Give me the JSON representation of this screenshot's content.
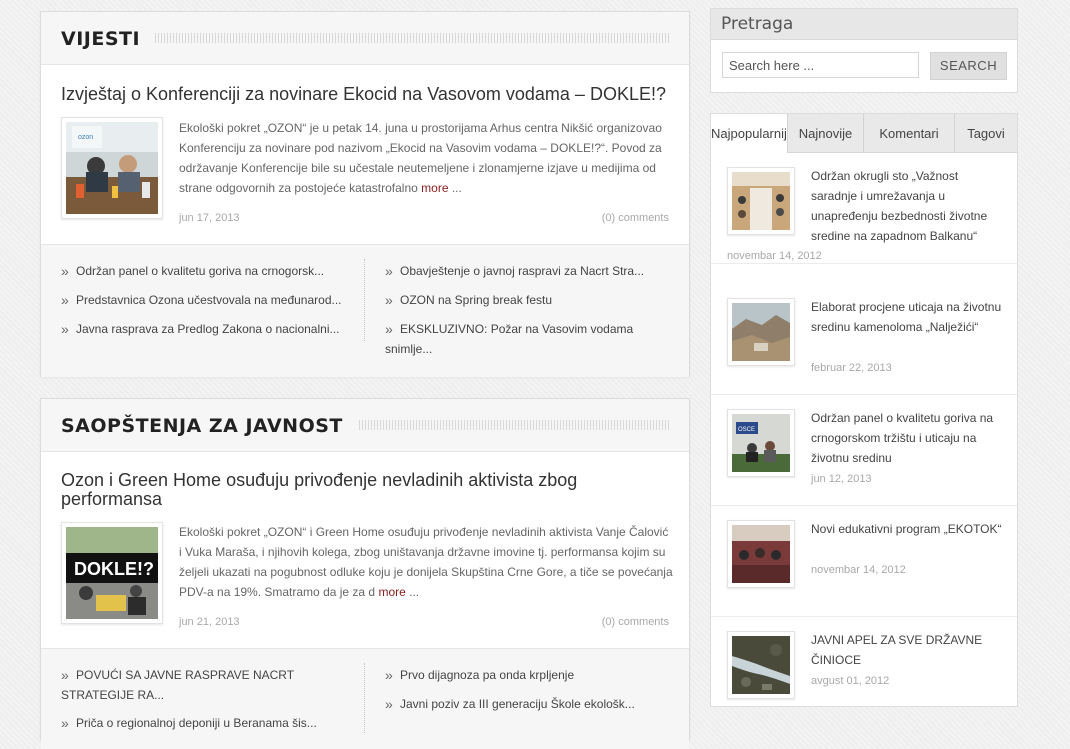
{
  "vijesti": {
    "heading": "VIJESTI",
    "post": {
      "title": "Izvještaj o Konferenciji za novinare Ekocid na Vasovom vodama – DOKLE!?",
      "excerpt": "Ekološki pokret „OZON“ je u petak 14. juna u prostorijama Arhus centra Nikšić organizovao Konferenciju za novinare pod nazivom „Ekocid na Vasovim vodama – DOKLE!?“. Povod za održavanje Konferencije bile su učestale neutemeljene i zlonamjerne izjave u medijima od strane odgovornih za postojeće katastrofalno",
      "more": "more",
      "ellipsis": " ...",
      "date": "jun 17, 2013",
      "comments": "(0) comments"
    },
    "links_left": [
      "Održan panel o kvalitetu goriva na crnogorsk...",
      "Predstavnica Ozona učestvovala na međunarod...",
      "Javna rasprava za Predlog Zakona o nacionalni..."
    ],
    "links_right": [
      "Obavještenje o javnoj raspravi za Nacrt Stra...",
      "OZON na Spring break festu",
      "EKSKLUZIVNO: Požar na Vasovim vodama snimlje..."
    ]
  },
  "saopstenja": {
    "heading": "SAOPŠTENJA ZA JAVNOST",
    "post": {
      "title": "Ozon i Green Home osuđuju privođenje nevladinih aktivista zbog performansa",
      "excerpt": "Ekološki pokret „OZON“ i Green Home osuđuju privođenje nevladinih aktivista Vanje Čalović i Vuka Maraša, i njihovih kolega, zbog uništavanja državne imovine tj. performansa kojim su željeli ukazati na pogubnost odluke koju je donijela Skupština Crne Gore, a tiče se povećanja PDV-a na 19%. Smatramo da je za d",
      "more": "more",
      "ellipsis": " ...",
      "date": "jun 21, 2013",
      "comments": "(0) comments"
    },
    "links_left": [
      "POVUĆI SA JAVNE RASPRAVE NACRT STRATEGIJE RA...",
      "Priča o regionalnoj deponiji u Beranama šis..."
    ],
    "links_right": [
      "Prvo dijagnoza pa onda krpljenje",
      "Javni poziv za III generaciju Škole ekološk..."
    ]
  },
  "search": {
    "title": "Pretraga",
    "placeholder": "Search here ...",
    "button": "SEARCH"
  },
  "tabs": [
    "Najpopularnije",
    "Najnovije",
    "Komentari",
    "Tagovi"
  ],
  "popular": [
    {
      "title": "Održan okrugli sto „Važnost saradnje i umrežavanja u unapređenju bezbednosti životne sredine na zapadnom Balkanu“",
      "date": "novembar 14, 2012"
    },
    {
      "title": "Elaborat procjene uticaja na životnu sredinu kamenoloma „Nalježići“",
      "date": "februar 22, 2013"
    },
    {
      "title": "Održan panel o kvalitetu goriva na crnogorskom tržištu i uticaju na životnu sredinu",
      "date": "jun 12, 2013"
    },
    {
      "title": "Novi edukativni program „EKOTOK“",
      "date": "novembar 14, 2012"
    },
    {
      "title": "JAVNI APEL ZA SVE DRŽAVNE ČINIOCE",
      "date": "avgust 01, 2012"
    }
  ]
}
